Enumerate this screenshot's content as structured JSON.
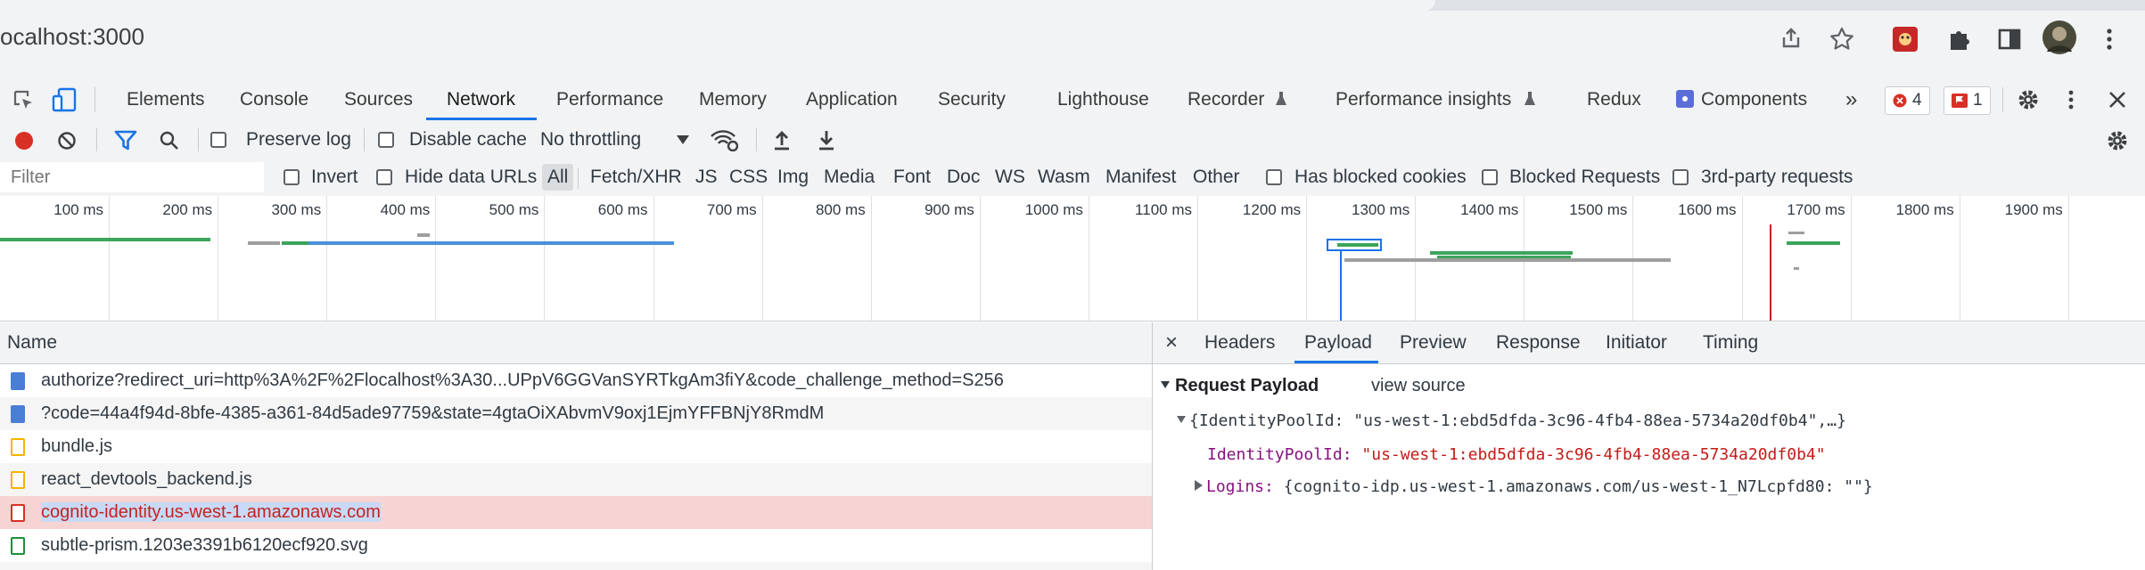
{
  "browser": {
    "url": "ocalhost:3000"
  },
  "devtools": {
    "tabs": [
      {
        "label": "Elements"
      },
      {
        "label": "Console"
      },
      {
        "label": "Sources"
      },
      {
        "label": "Network"
      },
      {
        "label": "Performance"
      },
      {
        "label": "Memory"
      },
      {
        "label": "Application"
      },
      {
        "label": "Security"
      },
      {
        "label": "Lighthouse"
      },
      {
        "label": "Recorder"
      },
      {
        "label": "Performance insights"
      },
      {
        "label": "Redux"
      },
      {
        "label": "Components"
      }
    ],
    "active_tab": "Network",
    "more_tabs": "»",
    "error_count": "4",
    "issue_count": "1"
  },
  "toolbar": {
    "preserve_log": "Preserve log",
    "disable_cache": "Disable cache",
    "throttling": "No throttling"
  },
  "filter": {
    "placeholder": "Filter",
    "invert": "Invert",
    "hide_data_urls": "Hide data URLs",
    "types": [
      "All",
      "Fetch/XHR",
      "JS",
      "CSS",
      "Img",
      "Media",
      "Font",
      "Doc",
      "WS",
      "Wasm",
      "Manifest",
      "Other"
    ],
    "has_blocked_cookies": "Has blocked cookies",
    "blocked_requests": "Blocked Requests",
    "third_party": "3rd-party requests"
  },
  "overview": {
    "ticks": [
      "100 ms",
      "200 ms",
      "300 ms",
      "400 ms",
      "500 ms",
      "600 ms",
      "700 ms",
      "800 ms",
      "900 ms",
      "1000 ms",
      "1100 ms",
      "1200 ms",
      "1300 ms",
      "1400 ms",
      "1500 ms",
      "1600 ms",
      "1700 ms",
      "1800 ms",
      "1900 ms",
      "200"
    ]
  },
  "requests": {
    "header": "Name",
    "rows": [
      {
        "name": "authorize?redirect_uri=http%3A%2F%2Flocalhost%3A30...UPpV6GGVanSYRTkgAm3fiY&code_challenge_method=S256",
        "type": "doc"
      },
      {
        "name": "?code=44a4f94d-8bfe-4385-a361-84d5ade97759&state=4gtaOiXAbvmV9oxj1EjmYFFBNjY8RmdM",
        "type": "doc"
      },
      {
        "name": "bundle.js",
        "type": "script"
      },
      {
        "name": "react_devtools_backend.js",
        "type": "script"
      },
      {
        "name": "cognito-identity.us-west-1.amazonaws.com",
        "type": "failed"
      },
      {
        "name": "subtle-prism.1203e3391b6120ecf920.svg",
        "type": "image"
      }
    ]
  },
  "detail": {
    "close": "×",
    "tabs": [
      "Headers",
      "Payload",
      "Preview",
      "Response",
      "Initiator",
      "Timing"
    ],
    "active_tab": "Payload",
    "section_title": "Request Payload",
    "view_source": "view source",
    "summary_line": "{IdentityPoolId: \"us-west-1:ebd5dfda-3c96-4fb4-88ea-5734a20df0b4\",…}",
    "identity_key": "IdentityPoolId:",
    "identity_value": "\"us-west-1:ebd5dfda-3c96-4fb4-88ea-5734a20df0b4\"",
    "logins_key": "Logins:",
    "logins_value": "{cognito-idp.us-west-1.amazonaws.com/us-west-1_N7Lcpfd80: \"\"}"
  }
}
